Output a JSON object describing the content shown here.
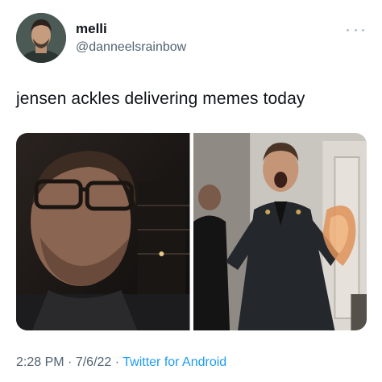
{
  "tweet": {
    "author": {
      "display_name": "melli",
      "handle": "@danneelsrainbow"
    },
    "text": "jensen ackles delivering memes today",
    "media": [
      {
        "description_icon": "photo-icon"
      },
      {
        "description_icon": "photo-icon"
      }
    ],
    "meta": {
      "time": "2:28 PM",
      "separator": "·",
      "date": "7/6/22",
      "source": "Twitter for Android"
    }
  },
  "colors": {
    "text_primary": "#0f1419",
    "text_secondary": "#536471",
    "link": "#1d9bf0"
  }
}
